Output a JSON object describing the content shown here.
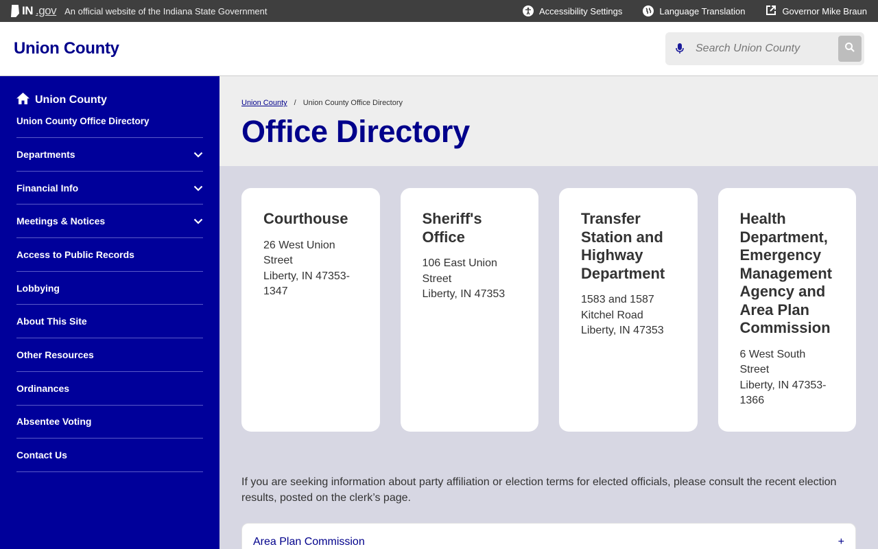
{
  "govbar": {
    "logo_in": "IN",
    "logo_gov": ".gov",
    "official_text": "An official website of the Indiana State Government",
    "links": [
      {
        "label": "Accessibility Settings",
        "icon": "accessibility-icon"
      },
      {
        "label": "Language Translation",
        "icon": "globe-icon"
      },
      {
        "label": "Governor Mike Braun",
        "icon": "external-link-icon"
      }
    ]
  },
  "header": {
    "site_title": "Union County",
    "search_placeholder": "Search Union County"
  },
  "sidebar": {
    "home_label": "Union County",
    "current_label": "Union County Office Directory",
    "items": [
      {
        "label": "Departments",
        "expandable": true
      },
      {
        "label": "Financial Info",
        "expandable": true
      },
      {
        "label": "Meetings & Notices",
        "expandable": true
      },
      {
        "label": "Access to Public Records",
        "expandable": false
      },
      {
        "label": "Lobbying",
        "expandable": false
      },
      {
        "label": "About This Site",
        "expandable": false
      },
      {
        "label": "Other Resources",
        "expandable": false
      },
      {
        "label": "Ordinances",
        "expandable": false
      },
      {
        "label": "Absentee Voting",
        "expandable": false
      },
      {
        "label": "Contact Us",
        "expandable": false
      }
    ]
  },
  "breadcrumb": {
    "home": "Union County",
    "separator": "/",
    "current": "Union County Office Directory"
  },
  "page_title": "Office Directory",
  "cards": [
    {
      "title": "Courthouse",
      "address": "26 West Union Street",
      "city": "Liberty, IN 47353-1347"
    },
    {
      "title": "Sheriff's Office",
      "address": "106 East Union Street",
      "city": "Liberty, IN 47353"
    },
    {
      "title": "Transfer Station and Highway Department",
      "address": "1583 and 1587 Kitchel Road",
      "city": "Liberty, IN 47353"
    },
    {
      "title": "Health Department, Emergency Management Agency and Area Plan Commission",
      "address": "6 West South Street",
      "city": "Liberty, IN 47353-1366"
    }
  ],
  "info_text": "If you are seeking information about party affiliation or election terms for elected officials, please consult the recent election results, posted on the clerk’s page.",
  "accordion": {
    "label": "Area Plan Commission",
    "toggle": "+"
  },
  "colors": {
    "brand_blue": "#00008b",
    "sidebar_blue": "#00009a",
    "govbar_bg": "#3f3f3f"
  }
}
